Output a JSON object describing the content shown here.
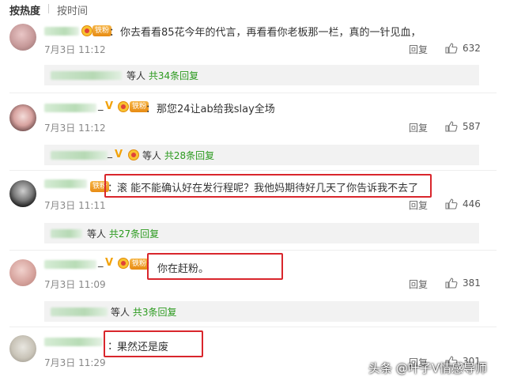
{
  "sort": {
    "hot_label": "按热度",
    "time_label": "按时间"
  },
  "comments": [
    {
      "badge": "铁粉",
      "colon": "：",
      "text": "你去看看85花今年的代言，再看看你老板那一栏，真的一针见血，",
      "time": "7月3日 11:12",
      "reply": "回复",
      "likes": "632",
      "sub": {
        "prefix": "等人",
        "link": "共34条回复"
      }
    },
    {
      "badge": "铁粉",
      "colon": "：",
      "text": "那您24让ab给我slay全场",
      "time": "7月3日 11:12",
      "reply": "回复",
      "likes": "587",
      "sub": {
        "prefix": "等人",
        "link": "共28条回复"
      }
    },
    {
      "badge": "铁粉",
      "colon": "：",
      "text": "滚 能不能确认好在发行程呢？我他妈期待好几天了你告诉我不去了",
      "time": "7月3日 11:11",
      "reply": "回复",
      "likes": "446",
      "sub": {
        "prefix": "等人",
        "link": "共27条回复"
      }
    },
    {
      "badge": "铁粉",
      "colon": "：",
      "text": "你在赶粉。",
      "time": "7月3日 11:09",
      "reply": "回复",
      "likes": "381",
      "sub": {
        "prefix": "等人",
        "link": "共3条回复"
      }
    },
    {
      "badge": "",
      "colon": "：",
      "text": "果然还是废",
      "time": "7月3日 11:29",
      "reply": "回复",
      "likes": "301",
      "sub": null
    }
  ],
  "watermark": "头条 @叶子V情感导师",
  "icons": {
    "like": "thumbs-up-icon",
    "verified": "v-verified-icon",
    "fan": "crown-icon"
  },
  "colors": {
    "link_green": "#2b9a1e",
    "highlight_red": "#d9262c",
    "badge_orange": "#f5a623"
  }
}
